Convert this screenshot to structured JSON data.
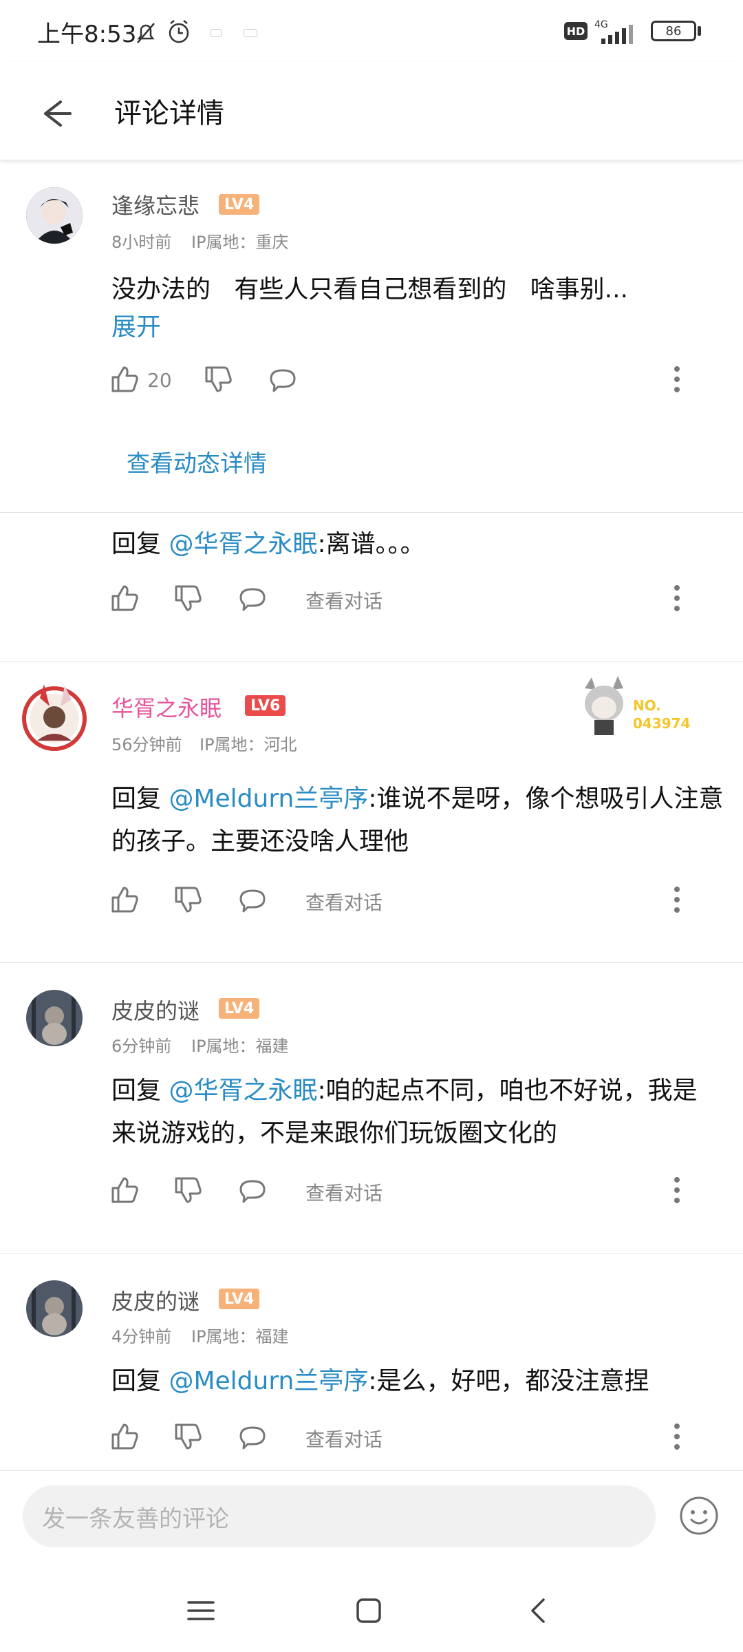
{
  "status": {
    "time": "上午8:53",
    "network": "4G",
    "hd": "HD",
    "battery": "86"
  },
  "header": {
    "title": "评论详情"
  },
  "comments": [
    {
      "username": "逢缘忘悲",
      "level": "LV4",
      "time": "8小时前",
      "ip": "IP属地：重庆",
      "text": "没办法的   有些人只看自己想看到的   啥事别...",
      "expand": "展开",
      "likes": "20",
      "detail_link": "查看动态详情"
    },
    {
      "reply_prefix": "回复",
      "mention": "@华胥之永眠",
      "text": ":离谱。。。",
      "view_conversation": "查看对话"
    },
    {
      "username": "华胥之永眠",
      "level": "LV6",
      "time": "56分钟前",
      "ip": "IP属地：河北",
      "badge_no": "NO.",
      "badge_num": "043974",
      "reply_prefix": "回复",
      "mention": "@Meldurn兰亭序",
      "text": ":谁说不是呀，像个想吸引人注意的孩子。主要还没啥人理他",
      "view_conversation": "查看对话"
    },
    {
      "username": "皮皮的谜",
      "level": "LV4",
      "time": "6分钟前",
      "ip": "IP属地：福建",
      "reply_prefix": "回复",
      "mention": "@华胥之永眠",
      "text": ":咱的起点不同，咱也不好说，我是来说游戏的，不是来跟你们玩饭圈文化的",
      "view_conversation": "查看对话"
    },
    {
      "username": "皮皮的谜",
      "level": "LV4",
      "time": "4分钟前",
      "ip": "IP属地：福建",
      "reply_prefix": "回复",
      "mention": "@Meldurn兰亭序",
      "text": ":是么，好吧，都没注意捏",
      "view_conversation": "查看对话"
    }
  ],
  "input": {
    "placeholder": "发一条友善的评论"
  },
  "icons": [
    "back-arrow-icon",
    "like-icon",
    "dislike-icon",
    "comment-icon",
    "more-icon",
    "emoji-icon",
    "menu-icon",
    "home-icon",
    "back-icon"
  ],
  "colors": {
    "link": "#2a8cc4",
    "pink_name": "#e8549b",
    "lv4": "#f6b278",
    "lv6": "#ea4b4b"
  }
}
